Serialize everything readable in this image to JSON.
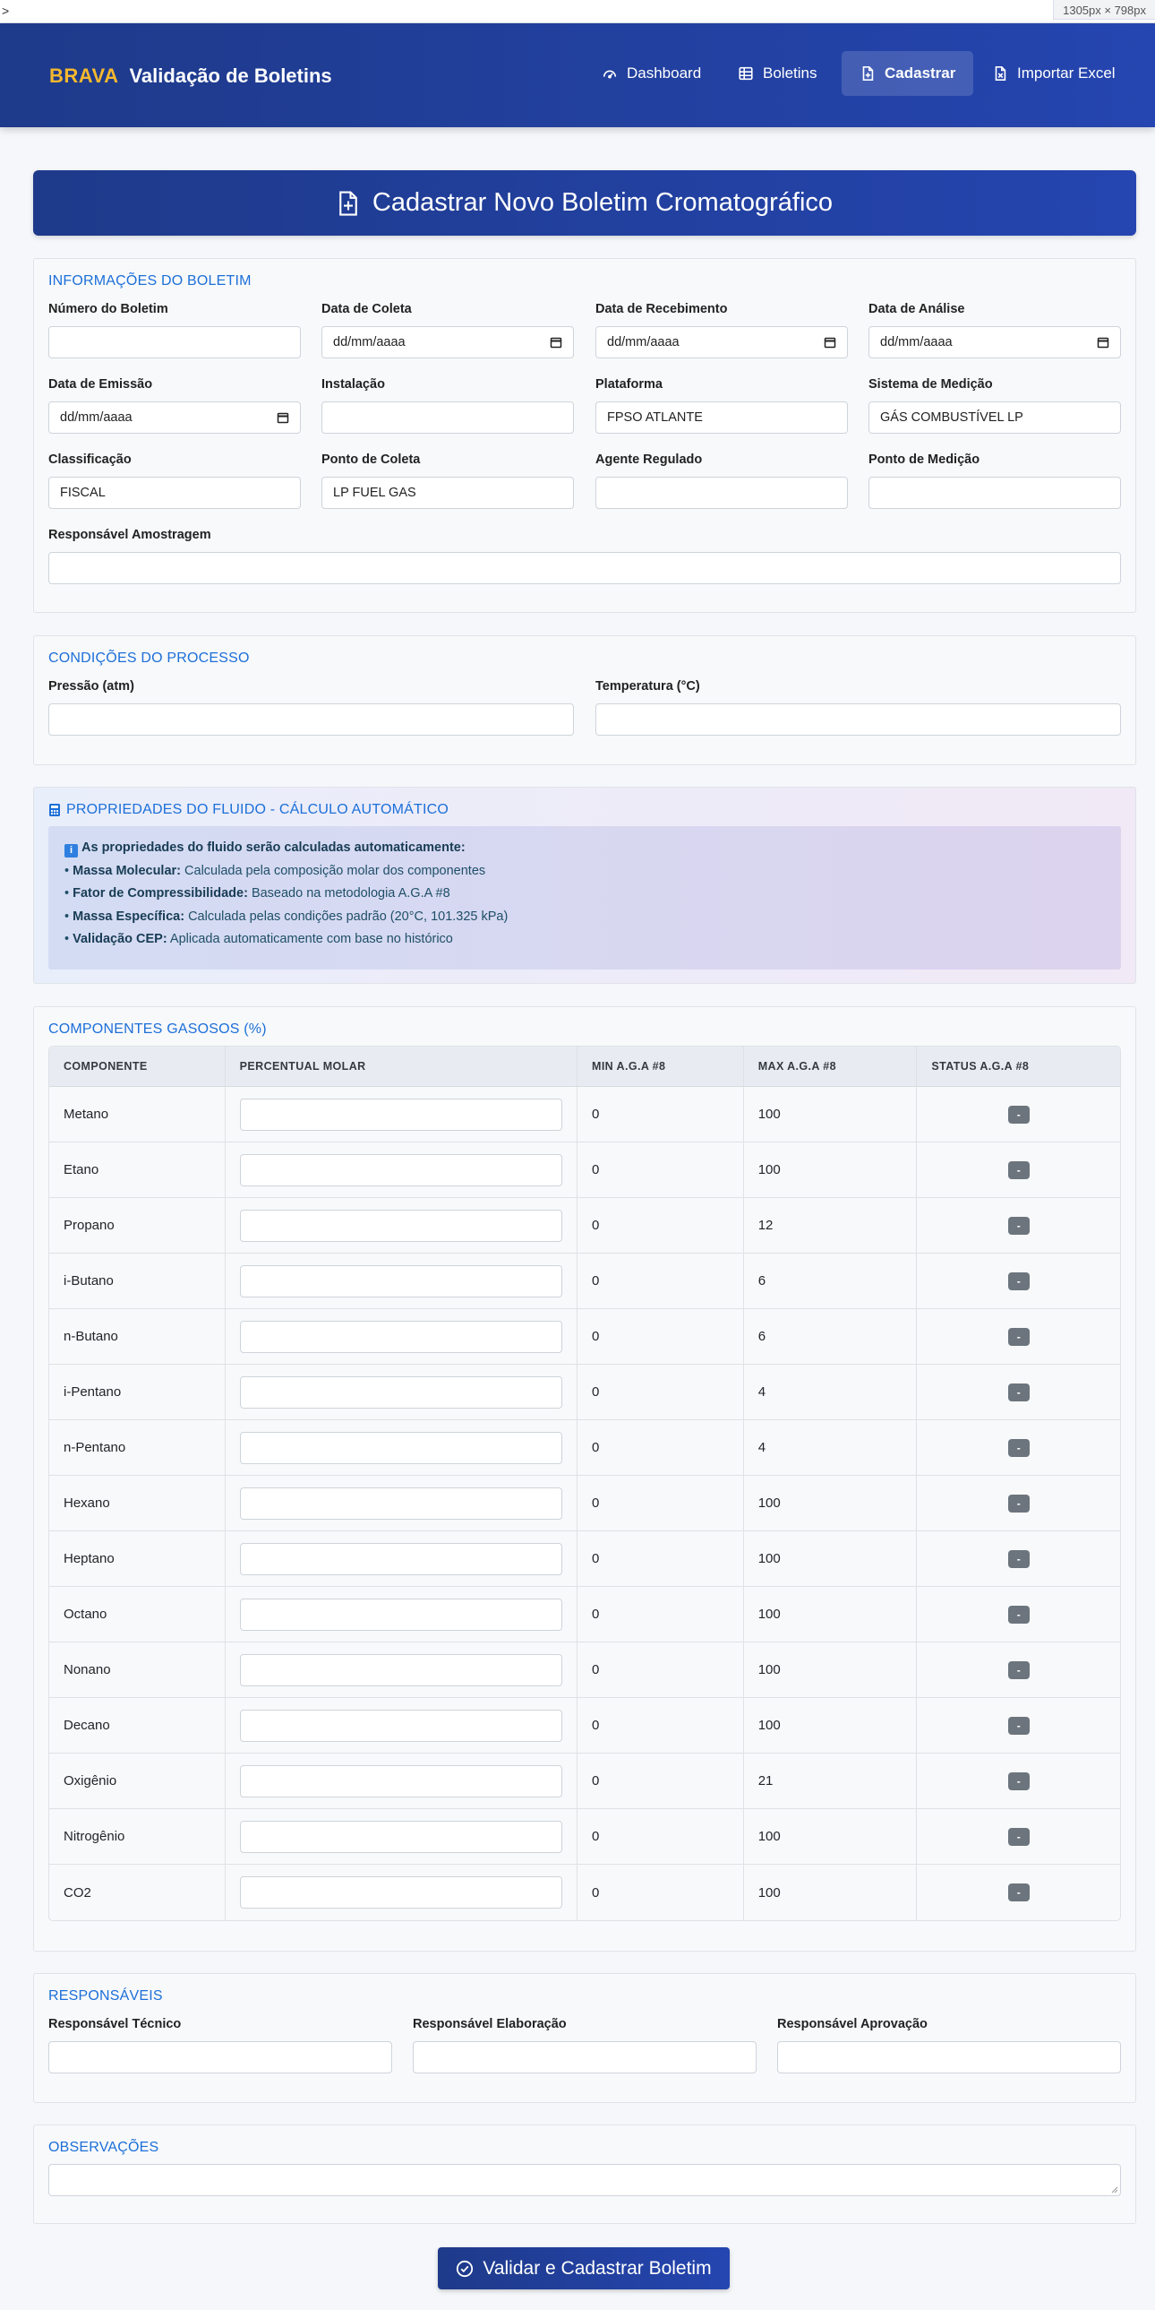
{
  "topstrip": {
    "caret": ">",
    "dims": "1305px × 798px"
  },
  "navbar": {
    "brand_short": "BRAVA",
    "brand_title": "Validação de Boletins",
    "items": [
      {
        "label": "Dashboard",
        "icon": "gauge-icon"
      },
      {
        "label": "Boletins",
        "icon": "table-icon"
      },
      {
        "label": "Cadastrar",
        "icon": "file-plus-icon",
        "active": true
      },
      {
        "label": "Importar Excel",
        "icon": "file-excel-icon"
      }
    ]
  },
  "hero": {
    "title": "Cadastrar Novo Boletim Cromatográfico"
  },
  "info": {
    "title": "INFORMAÇÕES DO BOLETIM",
    "fields": [
      {
        "label": "Número do Boletim",
        "value": ""
      },
      {
        "label": "Data de Coleta",
        "value": "dd/mm/aaaa"
      },
      {
        "label": "Data de Recebimento",
        "value": "dd/mm/aaaa"
      },
      {
        "label": "Data de Análise",
        "value": "dd/mm/aaaa"
      },
      {
        "label": "Data de Emissão",
        "value": "dd/mm/aaaa"
      },
      {
        "label": "Instalação",
        "value": ""
      },
      {
        "label": "Plataforma",
        "value": "FPSO ATLANTE"
      },
      {
        "label": "Sistema de Medição",
        "value": "GÁS COMBUSTÍVEL LP"
      },
      {
        "label": "Classificação",
        "value": "FISCAL"
      },
      {
        "label": "Ponto de Coleta",
        "value": "LP FUEL GAS"
      },
      {
        "label": "Agente Regulado",
        "value": ""
      },
      {
        "label": "Ponto de Medição",
        "value": ""
      },
      {
        "label": "Responsável Amostragem",
        "value": ""
      }
    ]
  },
  "process": {
    "title": "CONDIÇÕES DO PROCESSO",
    "fields": [
      {
        "label": "Pressão (atm)",
        "value": ""
      },
      {
        "label": "Temperatura (°C)",
        "value": ""
      }
    ]
  },
  "fluid": {
    "title": "PROPRIEDADES DO FLUIDO - CÁLCULO AUTOMÁTICO",
    "heading": "As propriedades do fluido serão calculadas automaticamente:",
    "items": [
      {
        "bold": "Massa Molecular:",
        "text": "Calculada pela composição molar dos componentes"
      },
      {
        "bold": "Fator de Compressibilidade:",
        "text": "Baseado na metodologia A.G.A #8"
      },
      {
        "bold": "Massa Específica:",
        "text": "Calculada pelas condições padrão (20°C, 101.325 kPa)"
      },
      {
        "bold": "Validação CEP:",
        "text": "Aplicada automaticamente com base no histórico"
      }
    ]
  },
  "components": {
    "title": "COMPONENTES GASOSOS (%)",
    "headers": [
      "COMPONENTE",
      "PERCENTUAL MOLAR",
      "MIN A.G.A #8",
      "MAX A.G.A #8",
      "STATUS A.G.A #8"
    ],
    "rows": [
      {
        "name": "Metano",
        "min": "0",
        "max": "100",
        "status": "-"
      },
      {
        "name": "Etano",
        "min": "0",
        "max": "100",
        "status": "-"
      },
      {
        "name": "Propano",
        "min": "0",
        "max": "12",
        "status": "-"
      },
      {
        "name": "i-Butano",
        "min": "0",
        "max": "6",
        "status": "-"
      },
      {
        "name": "n-Butano",
        "min": "0",
        "max": "6",
        "status": "-"
      },
      {
        "name": "i-Pentano",
        "min": "0",
        "max": "4",
        "status": "-"
      },
      {
        "name": "n-Pentano",
        "min": "0",
        "max": "4",
        "status": "-"
      },
      {
        "name": "Hexano",
        "min": "0",
        "max": "100",
        "status": "-"
      },
      {
        "name": "Heptano",
        "min": "0",
        "max": "100",
        "status": "-"
      },
      {
        "name": "Octano",
        "min": "0",
        "max": "100",
        "status": "-"
      },
      {
        "name": "Nonano",
        "min": "0",
        "max": "100",
        "status": "-"
      },
      {
        "name": "Decano",
        "min": "0",
        "max": "100",
        "status": "-"
      },
      {
        "name": "Oxigênio",
        "min": "0",
        "max": "21",
        "status": "-"
      },
      {
        "name": "Nitrogênio",
        "min": "0",
        "max": "100",
        "status": "-"
      },
      {
        "name": "CO2",
        "min": "0",
        "max": "100",
        "status": "-"
      }
    ]
  },
  "responsaveis": {
    "title": "RESPONSÁVEIS",
    "fields": [
      {
        "label": "Responsável Técnico",
        "value": ""
      },
      {
        "label": "Responsável Elaboração",
        "value": ""
      },
      {
        "label": "Responsável Aprovação",
        "value": ""
      }
    ]
  },
  "observacoes": {
    "title": "OBSERVAÇÕES",
    "value": ""
  },
  "submit": {
    "label": "Validar e Cadastrar Boletim"
  },
  "colors": {
    "navbar": "#1e3a8a",
    "brand_accent": "#f5b82e",
    "section_title": "#1c6fd8",
    "badge": "#6c757d"
  }
}
